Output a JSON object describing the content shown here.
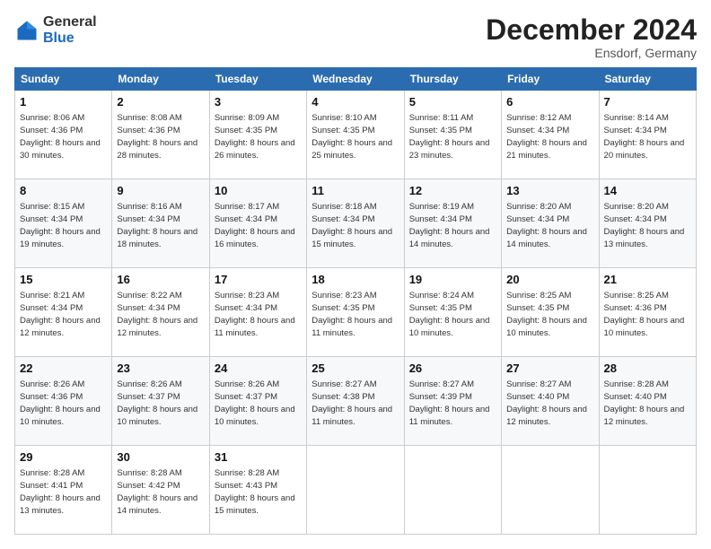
{
  "header": {
    "logo_general": "General",
    "logo_blue": "Blue",
    "title": "December 2024",
    "subtitle": "Ensdorf, Germany"
  },
  "days_of_week": [
    "Sunday",
    "Monday",
    "Tuesday",
    "Wednesday",
    "Thursday",
    "Friday",
    "Saturday"
  ],
  "weeks": [
    [
      {
        "day": "1",
        "sunrise": "Sunrise: 8:06 AM",
        "sunset": "Sunset: 4:36 PM",
        "daylight": "Daylight: 8 hours and 30 minutes."
      },
      {
        "day": "2",
        "sunrise": "Sunrise: 8:08 AM",
        "sunset": "Sunset: 4:36 PM",
        "daylight": "Daylight: 8 hours and 28 minutes."
      },
      {
        "day": "3",
        "sunrise": "Sunrise: 8:09 AM",
        "sunset": "Sunset: 4:35 PM",
        "daylight": "Daylight: 8 hours and 26 minutes."
      },
      {
        "day": "4",
        "sunrise": "Sunrise: 8:10 AM",
        "sunset": "Sunset: 4:35 PM",
        "daylight": "Daylight: 8 hours and 25 minutes."
      },
      {
        "day": "5",
        "sunrise": "Sunrise: 8:11 AM",
        "sunset": "Sunset: 4:35 PM",
        "daylight": "Daylight: 8 hours and 23 minutes."
      },
      {
        "day": "6",
        "sunrise": "Sunrise: 8:12 AM",
        "sunset": "Sunset: 4:34 PM",
        "daylight": "Daylight: 8 hours and 21 minutes."
      },
      {
        "day": "7",
        "sunrise": "Sunrise: 8:14 AM",
        "sunset": "Sunset: 4:34 PM",
        "daylight": "Daylight: 8 hours and 20 minutes."
      }
    ],
    [
      {
        "day": "8",
        "sunrise": "Sunrise: 8:15 AM",
        "sunset": "Sunset: 4:34 PM",
        "daylight": "Daylight: 8 hours and 19 minutes."
      },
      {
        "day": "9",
        "sunrise": "Sunrise: 8:16 AM",
        "sunset": "Sunset: 4:34 PM",
        "daylight": "Daylight: 8 hours and 18 minutes."
      },
      {
        "day": "10",
        "sunrise": "Sunrise: 8:17 AM",
        "sunset": "Sunset: 4:34 PM",
        "daylight": "Daylight: 8 hours and 16 minutes."
      },
      {
        "day": "11",
        "sunrise": "Sunrise: 8:18 AM",
        "sunset": "Sunset: 4:34 PM",
        "daylight": "Daylight: 8 hours and 15 minutes."
      },
      {
        "day": "12",
        "sunrise": "Sunrise: 8:19 AM",
        "sunset": "Sunset: 4:34 PM",
        "daylight": "Daylight: 8 hours and 14 minutes."
      },
      {
        "day": "13",
        "sunrise": "Sunrise: 8:20 AM",
        "sunset": "Sunset: 4:34 PM",
        "daylight": "Daylight: 8 hours and 14 minutes."
      },
      {
        "day": "14",
        "sunrise": "Sunrise: 8:20 AM",
        "sunset": "Sunset: 4:34 PM",
        "daylight": "Daylight: 8 hours and 13 minutes."
      }
    ],
    [
      {
        "day": "15",
        "sunrise": "Sunrise: 8:21 AM",
        "sunset": "Sunset: 4:34 PM",
        "daylight": "Daylight: 8 hours and 12 minutes."
      },
      {
        "day": "16",
        "sunrise": "Sunrise: 8:22 AM",
        "sunset": "Sunset: 4:34 PM",
        "daylight": "Daylight: 8 hours and 12 minutes."
      },
      {
        "day": "17",
        "sunrise": "Sunrise: 8:23 AM",
        "sunset": "Sunset: 4:34 PM",
        "daylight": "Daylight: 8 hours and 11 minutes."
      },
      {
        "day": "18",
        "sunrise": "Sunrise: 8:23 AM",
        "sunset": "Sunset: 4:35 PM",
        "daylight": "Daylight: 8 hours and 11 minutes."
      },
      {
        "day": "19",
        "sunrise": "Sunrise: 8:24 AM",
        "sunset": "Sunset: 4:35 PM",
        "daylight": "Daylight: 8 hours and 10 minutes."
      },
      {
        "day": "20",
        "sunrise": "Sunrise: 8:25 AM",
        "sunset": "Sunset: 4:35 PM",
        "daylight": "Daylight: 8 hours and 10 minutes."
      },
      {
        "day": "21",
        "sunrise": "Sunrise: 8:25 AM",
        "sunset": "Sunset: 4:36 PM",
        "daylight": "Daylight: 8 hours and 10 minutes."
      }
    ],
    [
      {
        "day": "22",
        "sunrise": "Sunrise: 8:26 AM",
        "sunset": "Sunset: 4:36 PM",
        "daylight": "Daylight: 8 hours and 10 minutes."
      },
      {
        "day": "23",
        "sunrise": "Sunrise: 8:26 AM",
        "sunset": "Sunset: 4:37 PM",
        "daylight": "Daylight: 8 hours and 10 minutes."
      },
      {
        "day": "24",
        "sunrise": "Sunrise: 8:26 AM",
        "sunset": "Sunset: 4:37 PM",
        "daylight": "Daylight: 8 hours and 10 minutes."
      },
      {
        "day": "25",
        "sunrise": "Sunrise: 8:27 AM",
        "sunset": "Sunset: 4:38 PM",
        "daylight": "Daylight: 8 hours and 11 minutes."
      },
      {
        "day": "26",
        "sunrise": "Sunrise: 8:27 AM",
        "sunset": "Sunset: 4:39 PM",
        "daylight": "Daylight: 8 hours and 11 minutes."
      },
      {
        "day": "27",
        "sunrise": "Sunrise: 8:27 AM",
        "sunset": "Sunset: 4:40 PM",
        "daylight": "Daylight: 8 hours and 12 minutes."
      },
      {
        "day": "28",
        "sunrise": "Sunrise: 8:28 AM",
        "sunset": "Sunset: 4:40 PM",
        "daylight": "Daylight: 8 hours and 12 minutes."
      }
    ],
    [
      {
        "day": "29",
        "sunrise": "Sunrise: 8:28 AM",
        "sunset": "Sunset: 4:41 PM",
        "daylight": "Daylight: 8 hours and 13 minutes."
      },
      {
        "day": "30",
        "sunrise": "Sunrise: 8:28 AM",
        "sunset": "Sunset: 4:42 PM",
        "daylight": "Daylight: 8 hours and 14 minutes."
      },
      {
        "day": "31",
        "sunrise": "Sunrise: 8:28 AM",
        "sunset": "Sunset: 4:43 PM",
        "daylight": "Daylight: 8 hours and 15 minutes."
      },
      null,
      null,
      null,
      null
    ]
  ]
}
